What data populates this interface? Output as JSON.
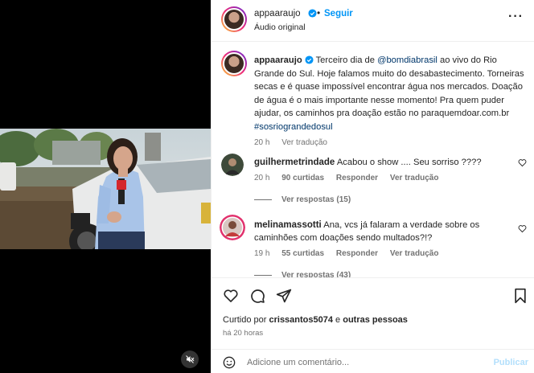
{
  "post": {
    "author": "appaaraujo",
    "follow_label": "Seguir",
    "separator": "•",
    "audio": "Áudio original",
    "more": "···"
  },
  "caption": {
    "username": "appaaraujo",
    "text_1": "Terceiro dia de ",
    "mention": "@bomdiabrasil",
    "text_2": " ao vivo do Rio Grande do Sul. Hoje falamos muito do desabastecimento. Torneiras secas e é quase impossível encontrar água nos mercados. Doação de água é o mais importante nesse momento! Pra quem puder ajudar, os caminhos pra doação estão no paraquemdoar.com.br ",
    "hashtag": "#sosriograndedosul",
    "time": "20 h",
    "translate": "Ver tradução"
  },
  "comments": [
    {
      "username": "guilhermetrindade",
      "text": "Acabou o show .... Seu sorriso ????",
      "time": "20 h",
      "likes": "90 curtidas",
      "reply": "Responder",
      "translate": "Ver tradução",
      "replies": "Ver respostas (15)"
    },
    {
      "username": "melinamassotti",
      "text": "Ana, vcs já falaram a verdade sobre os caminhões com doações sendo multados?!?",
      "time": "19 h",
      "likes": "55 curtidas",
      "reply": "Responder",
      "translate": "Ver tradução",
      "replies": "Ver respostas (43)"
    }
  ],
  "likes": {
    "prefix": "Curtido por ",
    "user": "crissantos5074",
    "middle": " e ",
    "others": "outras pessoas"
  },
  "timestamp": "há 20 horas",
  "comment_box": {
    "placeholder": "Adicione um comentário...",
    "publish": "Publicar"
  },
  "colors": {
    "accent": "#0095f6",
    "link": "#00376b",
    "muted": "#737373"
  },
  "icons": [
    "verified-icon",
    "more-icon",
    "heart-icon",
    "comment-icon",
    "share-icon",
    "bookmark-icon",
    "emoji-icon",
    "mute-icon"
  ]
}
